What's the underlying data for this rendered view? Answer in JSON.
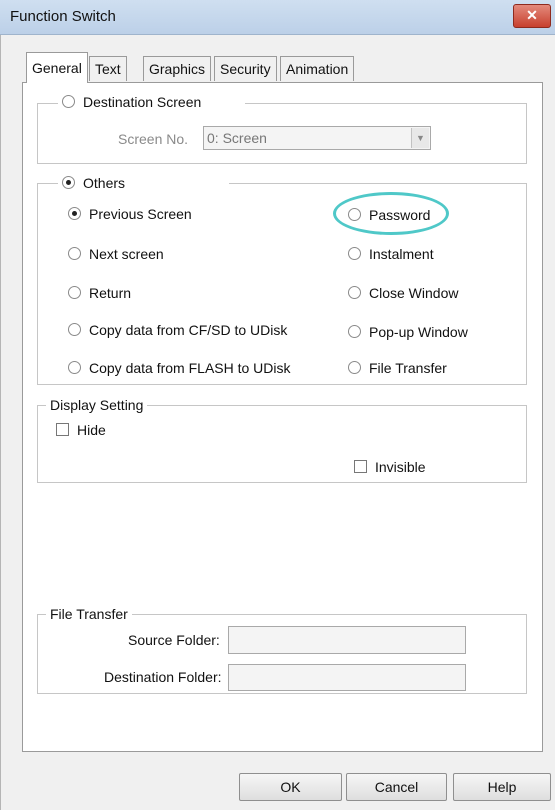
{
  "window": {
    "title": "Function Switch",
    "close_glyph": "✕"
  },
  "tabs": [
    {
      "label": "General",
      "active": true
    },
    {
      "label": "Text"
    },
    {
      "label": "Graphics"
    },
    {
      "label": "Security"
    },
    {
      "label": "Animation"
    }
  ],
  "destination_screen": {
    "label": "Destination Screen",
    "screen_no_label": "Screen No.",
    "screen_no_value": "0: Screen"
  },
  "others": {
    "label": "Others",
    "left_options": [
      {
        "label": "Previous Screen",
        "selected": true
      },
      {
        "label": "Next screen"
      },
      {
        "label": "Return"
      },
      {
        "label": "Copy data from CF/SD to UDisk"
      },
      {
        "label": "Copy data from FLASH to UDisk"
      }
    ],
    "right_options": [
      {
        "label": "Password"
      },
      {
        "label": "Instalment"
      },
      {
        "label": "Close Window"
      },
      {
        "label": "Pop-up Window"
      },
      {
        "label": "File Transfer"
      }
    ]
  },
  "display_setting": {
    "label": "Display Setting",
    "hide_label": "Hide",
    "invisible_label": "Invisible"
  },
  "file_transfer": {
    "label": "File Transfer",
    "source_label": "Source Folder:",
    "destination_label": "Destination Folder:",
    "source_value": "",
    "destination_value": ""
  },
  "buttons": {
    "ok": "OK",
    "cancel": "Cancel",
    "help": "Help"
  },
  "colors": {
    "highlight_ring": "#4fc8c8",
    "close_button": "#c7402e"
  }
}
